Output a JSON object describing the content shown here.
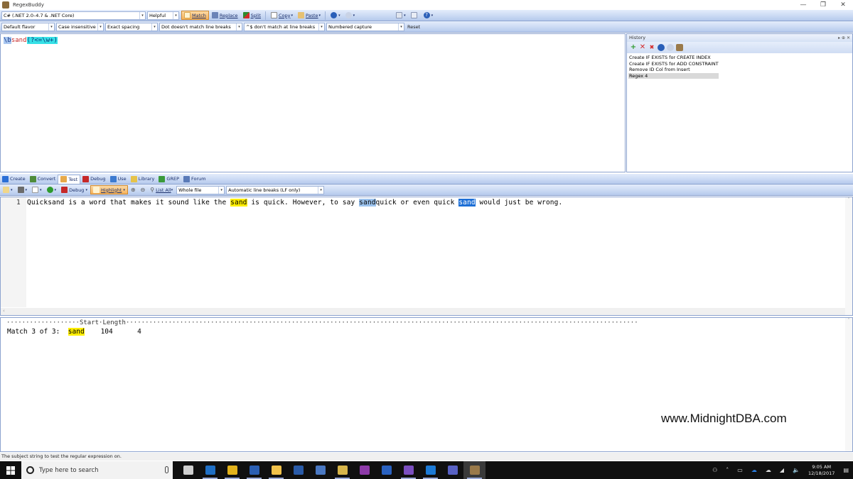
{
  "window": {
    "title": "RegexBuddy",
    "minimize": "—",
    "restore": "❐",
    "close": "✕"
  },
  "toolbar1": {
    "flavor": "C# (.NET 2.0–4.7 & .NET Core)",
    "helpfulness": "Helpful",
    "match": "Match",
    "replace": "Replace",
    "split": "Split",
    "copy": "Copy",
    "paste": "Paste"
  },
  "toolbar2": {
    "flavor_mode": "Default flavor",
    "case": "Case insensitive",
    "spacing": "Exact spacing",
    "dot": "Dot doesn't match line breaks",
    "anchors": "^$ don't match at line breaks",
    "capture": "Numbered capture",
    "reset": "Reset"
  },
  "regex": {
    "parts": [
      {
        "text": "\\b",
        "kind": "escape"
      },
      {
        "text": "sand",
        "kind": "literal"
      },
      {
        "text": "(?<=\\w+)",
        "kind": "group"
      }
    ]
  },
  "history": {
    "title": "History",
    "controls": "▸ ⊕ ✕",
    "items": [
      {
        "label": "Create IF EXISTS for CREATE INDEX",
        "selected": false
      },
      {
        "label": "Create IF EXISTS for ADD CONSTRAINT",
        "selected": false
      },
      {
        "label": "Remove ID Col from Insert",
        "selected": false
      },
      {
        "label": "Regex 4",
        "selected": true
      }
    ]
  },
  "tabs": [
    {
      "label": "Create",
      "active": false,
      "color": "#2b6fd6"
    },
    {
      "label": "Convert",
      "active": false,
      "color": "#4f8c3a"
    },
    {
      "label": "Test",
      "active": true,
      "color": "#e7a94a"
    },
    {
      "label": "Debug",
      "active": false,
      "color": "#c62828"
    },
    {
      "label": "Use",
      "active": false,
      "color": "#3d7bd0"
    },
    {
      "label": "Library",
      "active": false,
      "color": "#e6c34a"
    },
    {
      "label": "GREP",
      "active": false,
      "color": "#3a9a3a"
    },
    {
      "label": "Forum",
      "active": false,
      "color": "#5a7ab8"
    }
  ],
  "toolbar3": {
    "debug": "Debug",
    "highlight": "Highlight",
    "list_all": "List All",
    "scope": "Whole file",
    "line_breaks": "Automatic line breaks (LF only)"
  },
  "test": {
    "line_number": "1",
    "segments": [
      {
        "text": "Quicksand is a word that makes it sound like the ",
        "hl": ""
      },
      {
        "text": "sand",
        "hl": "yellow"
      },
      {
        "text": " is quick. However, to say ",
        "hl": ""
      },
      {
        "text": "sand",
        "hl": "blue-light"
      },
      {
        "text": "quick or even quick ",
        "hl": ""
      },
      {
        "text": "sand",
        "hl": "blue-dark"
      },
      {
        "text": " would just be wrong.",
        "hl": ""
      }
    ]
  },
  "results": {
    "header": "···················Start·Length·····································································································································",
    "match_label": "Match 3 of 3:  ",
    "match_text": "sand",
    "start": "104",
    "length": "4",
    "watermark": "www.MidnightDBA.com"
  },
  "status": {
    "text": "The subject string to test the regular expression on."
  },
  "taskbar": {
    "search_placeholder": "Type here to search",
    "apps": [
      {
        "name": "task-view",
        "color": "#cfcfcf",
        "open": false,
        "current": false
      },
      {
        "name": "outlook",
        "color": "#1f6fc5",
        "open": true,
        "current": false
      },
      {
        "name": "chrome",
        "color": "#e2b21c",
        "open": true,
        "current": false
      },
      {
        "name": "word",
        "color": "#2b5fb3",
        "open": true,
        "current": false
      },
      {
        "name": "file-explorer",
        "color": "#f1c24b",
        "open": true,
        "current": false
      },
      {
        "name": "powershell",
        "color": "#2a5ba8",
        "open": false,
        "current": false
      },
      {
        "name": "remote-desktop",
        "color": "#4a78c2",
        "open": false,
        "current": false
      },
      {
        "name": "sql-tool",
        "color": "#d7b54a",
        "open": true,
        "current": false
      },
      {
        "name": "onenote",
        "color": "#8d3aa8",
        "open": false,
        "current": false
      },
      {
        "name": "calculator",
        "color": "#2a62c0",
        "open": false,
        "current": false
      },
      {
        "name": "visual-studio",
        "color": "#7b4fc0",
        "open": true,
        "current": false
      },
      {
        "name": "edge",
        "color": "#1c7ad6",
        "open": true,
        "current": false
      },
      {
        "name": "teams",
        "color": "#5861c3",
        "open": false,
        "current": false
      },
      {
        "name": "regexbuddy",
        "color": "#9a7a4a",
        "open": true,
        "current": true
      }
    ],
    "time": "9:05 AM",
    "date": "12/18/2017"
  }
}
